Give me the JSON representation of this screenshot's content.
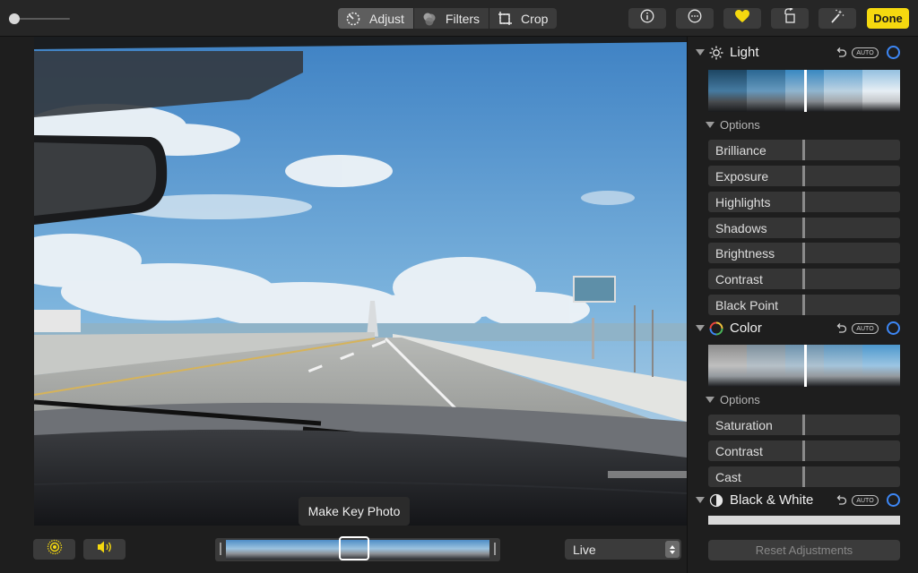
{
  "toolbar": {
    "tabs": [
      {
        "label": "Adjust",
        "icon": "adjust-dial-icon",
        "active": true
      },
      {
        "label": "Filters",
        "icon": "filters-circles-icon",
        "active": false
      },
      {
        "label": "Crop",
        "icon": "crop-icon",
        "active": false
      }
    ],
    "buttons": [
      "info-icon",
      "more-ellipsis-icon",
      "favorite-heart-icon",
      "rotate-icon",
      "magic-wand-icon"
    ],
    "done_label": "Done",
    "accent_color": "#f5d90f",
    "favorite_color": "#f5d90f"
  },
  "bottom_bar": {
    "live_toggle_icon": "live-photo-icon",
    "sound_icon": "speaker-icon",
    "tooltip": "Make Key Photo",
    "live_select_value": "Live"
  },
  "panel": {
    "sections": [
      {
        "title": "Light",
        "icon": "sun-icon",
        "auto": "AUTO",
        "options_label": "Options",
        "sliders": [
          "Brilliance",
          "Exposure",
          "Highlights",
          "Shadows",
          "Brightness",
          "Contrast",
          "Black Point"
        ]
      },
      {
        "title": "Color",
        "icon": "color-wheel-icon",
        "auto": "AUTO",
        "options_label": "Options",
        "sliders": [
          "Saturation",
          "Contrast",
          "Cast"
        ]
      },
      {
        "title": "Black & White",
        "icon": "half-circle-icon",
        "auto": "AUTO"
      }
    ],
    "reset_label": "Reset Adjustments",
    "toggle_color": "#3d87f5"
  }
}
